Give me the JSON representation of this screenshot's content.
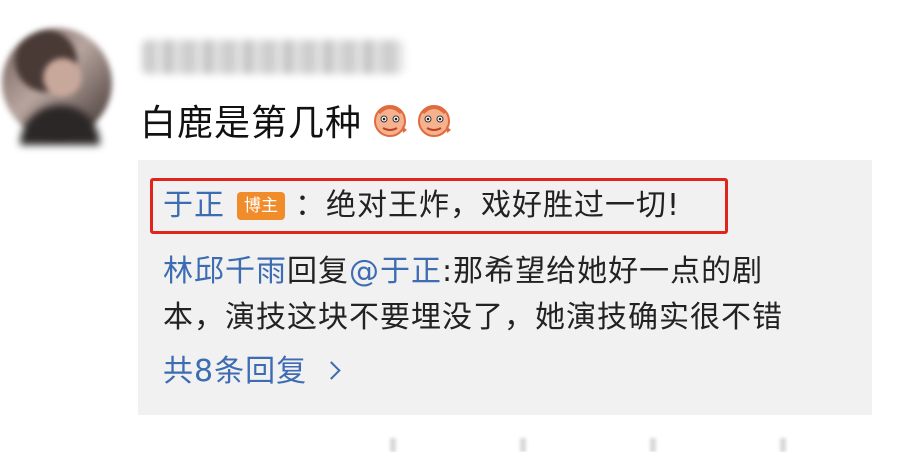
{
  "comment": {
    "text": "白鹿是第几种",
    "emojis": [
      "shrimp-emoji",
      "shrimp-emoji"
    ]
  },
  "replies": {
    "highlighted": {
      "author": "于正",
      "badge": "博主",
      "separator": "：",
      "text": "绝对王炸，戏好胜过一切!"
    },
    "reply2": {
      "author": "林邱千雨",
      "action": "回复",
      "mention": "@于正",
      "text_line1": ":那希望给她好一点的剧",
      "text_line2": "本，演技这块不要埋没了，她演技确实很不错"
    },
    "more_label": "共8条回复"
  },
  "colors": {
    "link": "#3d6cb3",
    "badge": "#f08c2a",
    "highlight_border": "#e0241e",
    "reply_background": "#f1f1f1"
  }
}
